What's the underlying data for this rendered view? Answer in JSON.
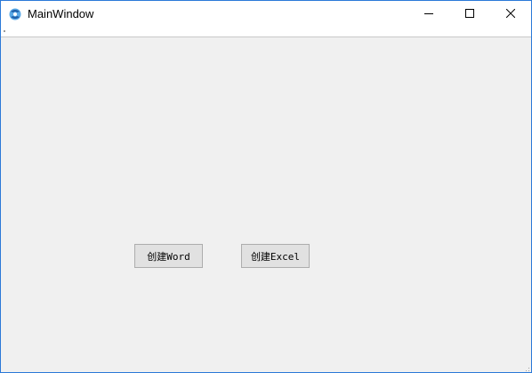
{
  "window": {
    "title": "MainWindow",
    "icon": "qt-logo-icon",
    "controls": {
      "minimize": "minimize-icon",
      "maximize": "maximize-icon",
      "close": "close-icon"
    },
    "border_color": "#2b79d8"
  },
  "main": {
    "buttons": {
      "create_word_label": "创建Word",
      "create_excel_label": "创建Excel"
    }
  },
  "colors": {
    "client_background": "#f0f0f0",
    "button_background": "#e1e1e1",
    "button_border": "#adadad"
  }
}
